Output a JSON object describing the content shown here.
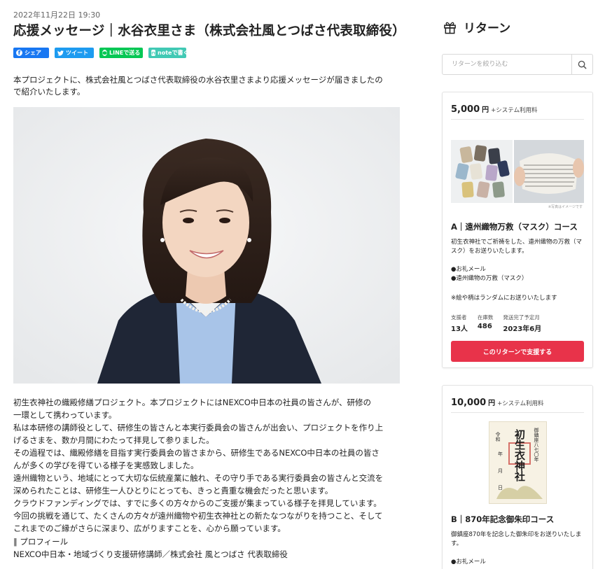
{
  "article": {
    "date": "2022年11月22日 19:30",
    "title": "応援メッセージ｜水谷衣里さま（株式会社風とつばさ代表取締役）",
    "share": {
      "facebook": "シェア",
      "twitter": "ツイート",
      "line": "LINEで送る",
      "note": "noteで書く"
    },
    "intro_lines": [
      "本プロジェクトに、株式会社風とつばさ代表取締役の水谷衣里さまより応援メッセージが届きましたの",
      "で紹介いたします。"
    ],
    "body_lines": [
      "初生衣神社の織殿修繕プロジェクト。本プロジェクトにはNEXCO中日本の社員の皆さんが、研修の",
      "一環として携わっています。",
      "私は本研修の講師役として、研修生の皆さんと本実行委員会の皆さんが出会い、プロジェクトを作り上",
      "げるさまを、数か月間にわたって拝見して参りました。",
      "その過程では、織殿修繕を目指す実行委員会の皆さまから、研修生であるNEXCO中日本の社員の皆さ",
      "んが多くの学びを得ている様子を実感致しました。",
      "遠州織物という、地域にとって大切な伝統産業に触れ、その守り手である実行委員会の皆さんと交流を",
      "深められたことは、研修生一人ひとりにとっても、きっと貴重な機会だったと思います。",
      "クラウドファンディングでは、すでに多くの方々からのご支援が集まっている様子を拝見しています。",
      "今回の挑戦を通じて、たくさんの方々が遠州織物や初生衣神社との新たなつながりを持つこと、そして",
      "これまでのご縁がさらに深まり、広がりますことを、心から願っています。"
    ],
    "profile_heading": "‖ プロフィール",
    "profile_text": "NEXCO中日本・地域づくり支援研修講師／株式会社 風とつばさ 代表取締役"
  },
  "sidebar": {
    "title": "リターン",
    "search_placeholder": "リターンを絞り込む",
    "rewards": [
      {
        "price": "5,000",
        "yen": "円",
        "system_fee": "+システム利用料",
        "image_caption": "※写真はイメージです",
        "name": "A｜遠州織物万救（マスク）コース",
        "desc1": "初生衣神社でご祈祷をした、遠州織物の万救（マスク）をお送りいたします。",
        "items": [
          "●お礼メール",
          "●遠州織物の万救（マスク）"
        ],
        "note": "※絵や柄はランダムにお送りいたします",
        "stats": [
          {
            "label": "支援者",
            "value": "13人"
          },
          {
            "label": "在庫数",
            "value": "486"
          },
          {
            "label": "発送完了予定月",
            "value": "2023年6月"
          }
        ],
        "button": "このリターンで支援する"
      },
      {
        "price": "10,000",
        "yen": "円",
        "system_fee": "+システム利用料",
        "stamp_text": {
          "top": "御鎮座八七〇年",
          "main": "初生衣神社",
          "left1": "令和",
          "left2": "年",
          "left3": "月",
          "left4": "日"
        },
        "name": "B｜870年記念御朱印コース",
        "desc1": "御鎮座870年を記念した御朱印をお送りいたします。",
        "items": [
          "●お礼メール"
        ]
      }
    ]
  },
  "colors": {
    "accent": "#e8334a",
    "facebook": "#1877f2",
    "twitter": "#1d9bf0",
    "line": "#06c755",
    "note": "#41c9b4"
  }
}
